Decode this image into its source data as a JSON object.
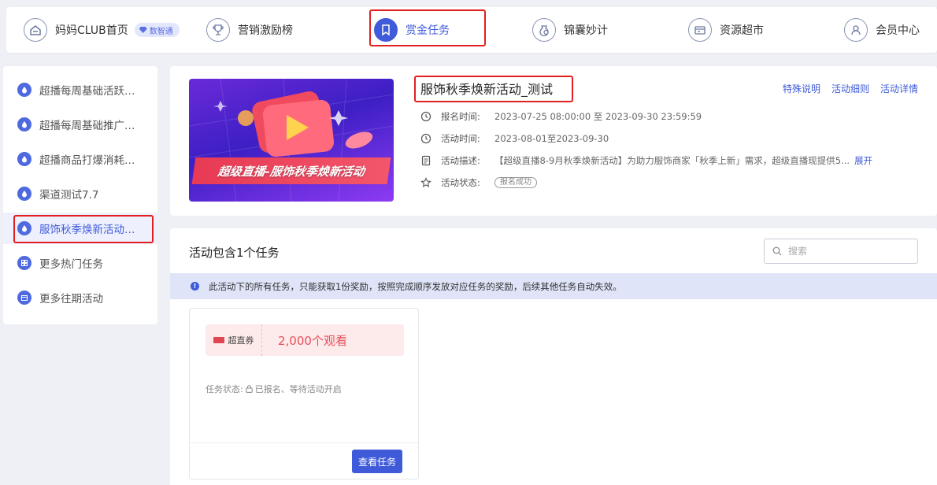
{
  "nav": {
    "items": [
      {
        "label": "妈妈CLUB首页",
        "icon": "home-icon",
        "badge": "数智通"
      },
      {
        "label": "营销激励榜",
        "icon": "trophy-icon"
      },
      {
        "label": "赏金任务",
        "icon": "bookmark-icon",
        "active": true
      },
      {
        "label": "锦囊妙计",
        "icon": "bag-icon"
      },
      {
        "label": "资源超市",
        "icon": "card-icon"
      },
      {
        "label": "会员中心",
        "icon": "user-icon"
      }
    ]
  },
  "sidebar": {
    "items": [
      {
        "label": "超播每周基础活跃…",
        "icon": "drop-icon"
      },
      {
        "label": "超播每周基础推广…",
        "icon": "drop-icon"
      },
      {
        "label": "超播商品打爆消耗…",
        "icon": "drop-icon"
      },
      {
        "label": "渠道测试7.7",
        "icon": "drop-icon"
      },
      {
        "label": "服饰秋季焕新活动…",
        "icon": "drop-icon",
        "active": true
      },
      {
        "label": "更多热门任务",
        "icon": "grid-icon"
      },
      {
        "label": "更多往期活动",
        "icon": "calendar-icon"
      }
    ]
  },
  "activity": {
    "banner_text": "超级直播-服饰秋季焕新活动",
    "title": "服饰秋季焕新活动_测试",
    "links": [
      "特殊说明",
      "活动细则",
      "活动详情"
    ],
    "signup_label": "报名时间:",
    "signup_value": "2023-07-25 08:00:00  至  2023-09-30 23:59:59",
    "time_label": "活动时间:",
    "time_value": "2023-08-01至2023-09-30",
    "desc_label": "活动描述:",
    "desc_value": "【超级直播8-9月秋季焕新活动】为助力服饰商家「秋季上新」需求，超级直播现提供5...",
    "desc_expand": "展开",
    "status_label": "活动状态:",
    "status_value": "报名成功"
  },
  "tasks": {
    "heading": "活动包含1个任务",
    "search_placeholder": "搜索",
    "notice": "此活动下的所有任务，只能获取1份奖励，按照完成顺序发放对应任务的奖励，后续其他任务自动失效。",
    "card": {
      "coupon_type": "超直券",
      "goal": "2,000个观看",
      "status_label": "任务状态:",
      "status_text": "已报名、等待活动开启",
      "button": "查看任务"
    }
  },
  "colors": {
    "accent": "#3f5bd9",
    "highlight": "#e02020",
    "coupon_bg": "#fdeaea",
    "coupon_text": "#e8505b"
  }
}
